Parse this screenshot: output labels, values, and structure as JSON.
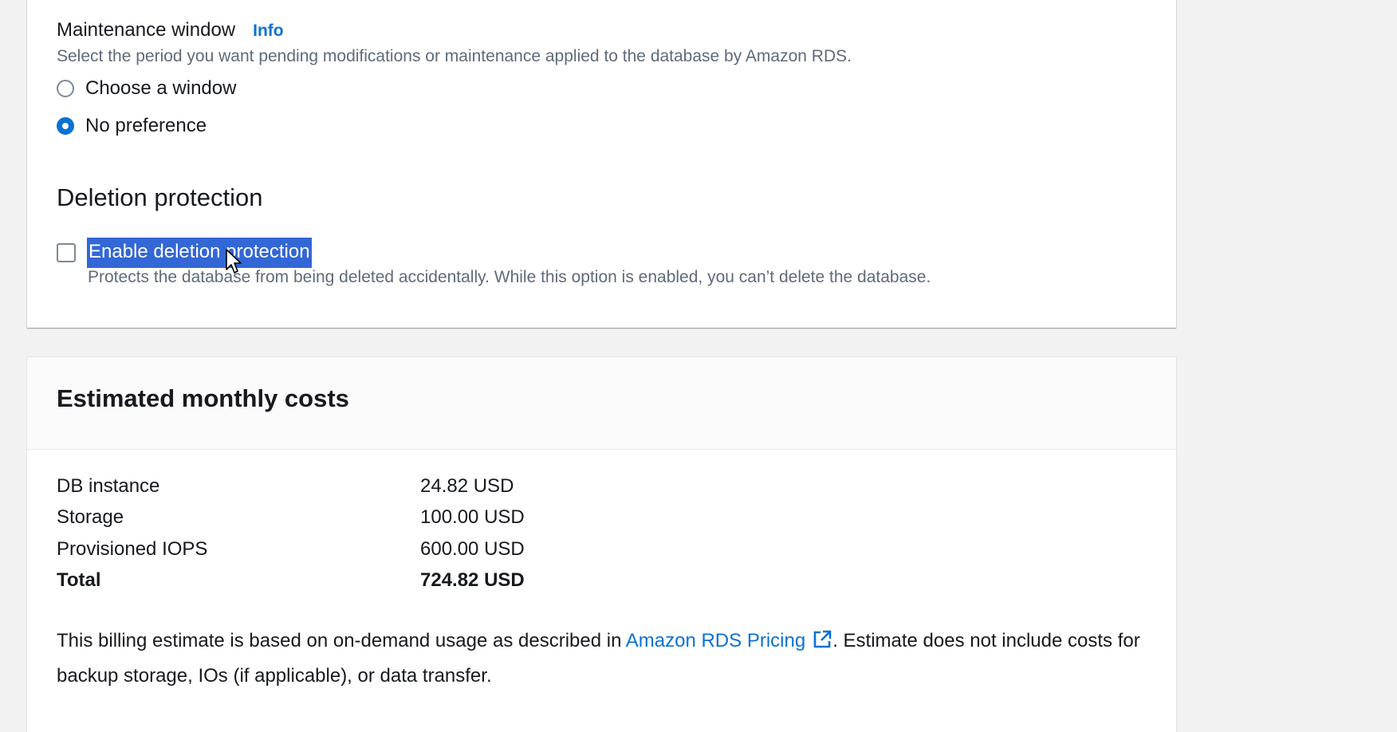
{
  "maintenance": {
    "label": "Maintenance window",
    "info_link": "Info",
    "description": "Select the period you want pending modifications or maintenance applied to the database by Amazon RDS.",
    "options": [
      {
        "label": "Choose a window",
        "selected": false
      },
      {
        "label": "No preference",
        "selected": true
      }
    ]
  },
  "deletion": {
    "heading": "Deletion protection",
    "checkbox_label": "Enable deletion protection",
    "checked": false,
    "description": "Protects the database from being deleted accidentally. While this option is enabled, you can’t delete the database."
  },
  "costs": {
    "title": "Estimated monthly costs",
    "rows": [
      {
        "name": "DB instance",
        "value": "24.82 USD"
      },
      {
        "name": "Storage",
        "value": "100.00 USD"
      },
      {
        "name": "Provisioned IOPS",
        "value": "600.00 USD"
      },
      {
        "name": "Total",
        "value": "724.82 USD"
      }
    ],
    "note_before": "This billing estimate is based on on-demand usage as described in ",
    "pricing_link": "Amazon RDS Pricing",
    "note_after": ". Estimate does not include costs for backup storage, IOs (if applicable), or data transfer."
  },
  "colors": {
    "accent": "#0972d3",
    "selection": "#3367d6",
    "muted_text": "#5f6b7a",
    "background": "#f2f2f2"
  },
  "icons": {
    "external_link": "external-link-icon",
    "cursor": "mouse-cursor-icon"
  }
}
